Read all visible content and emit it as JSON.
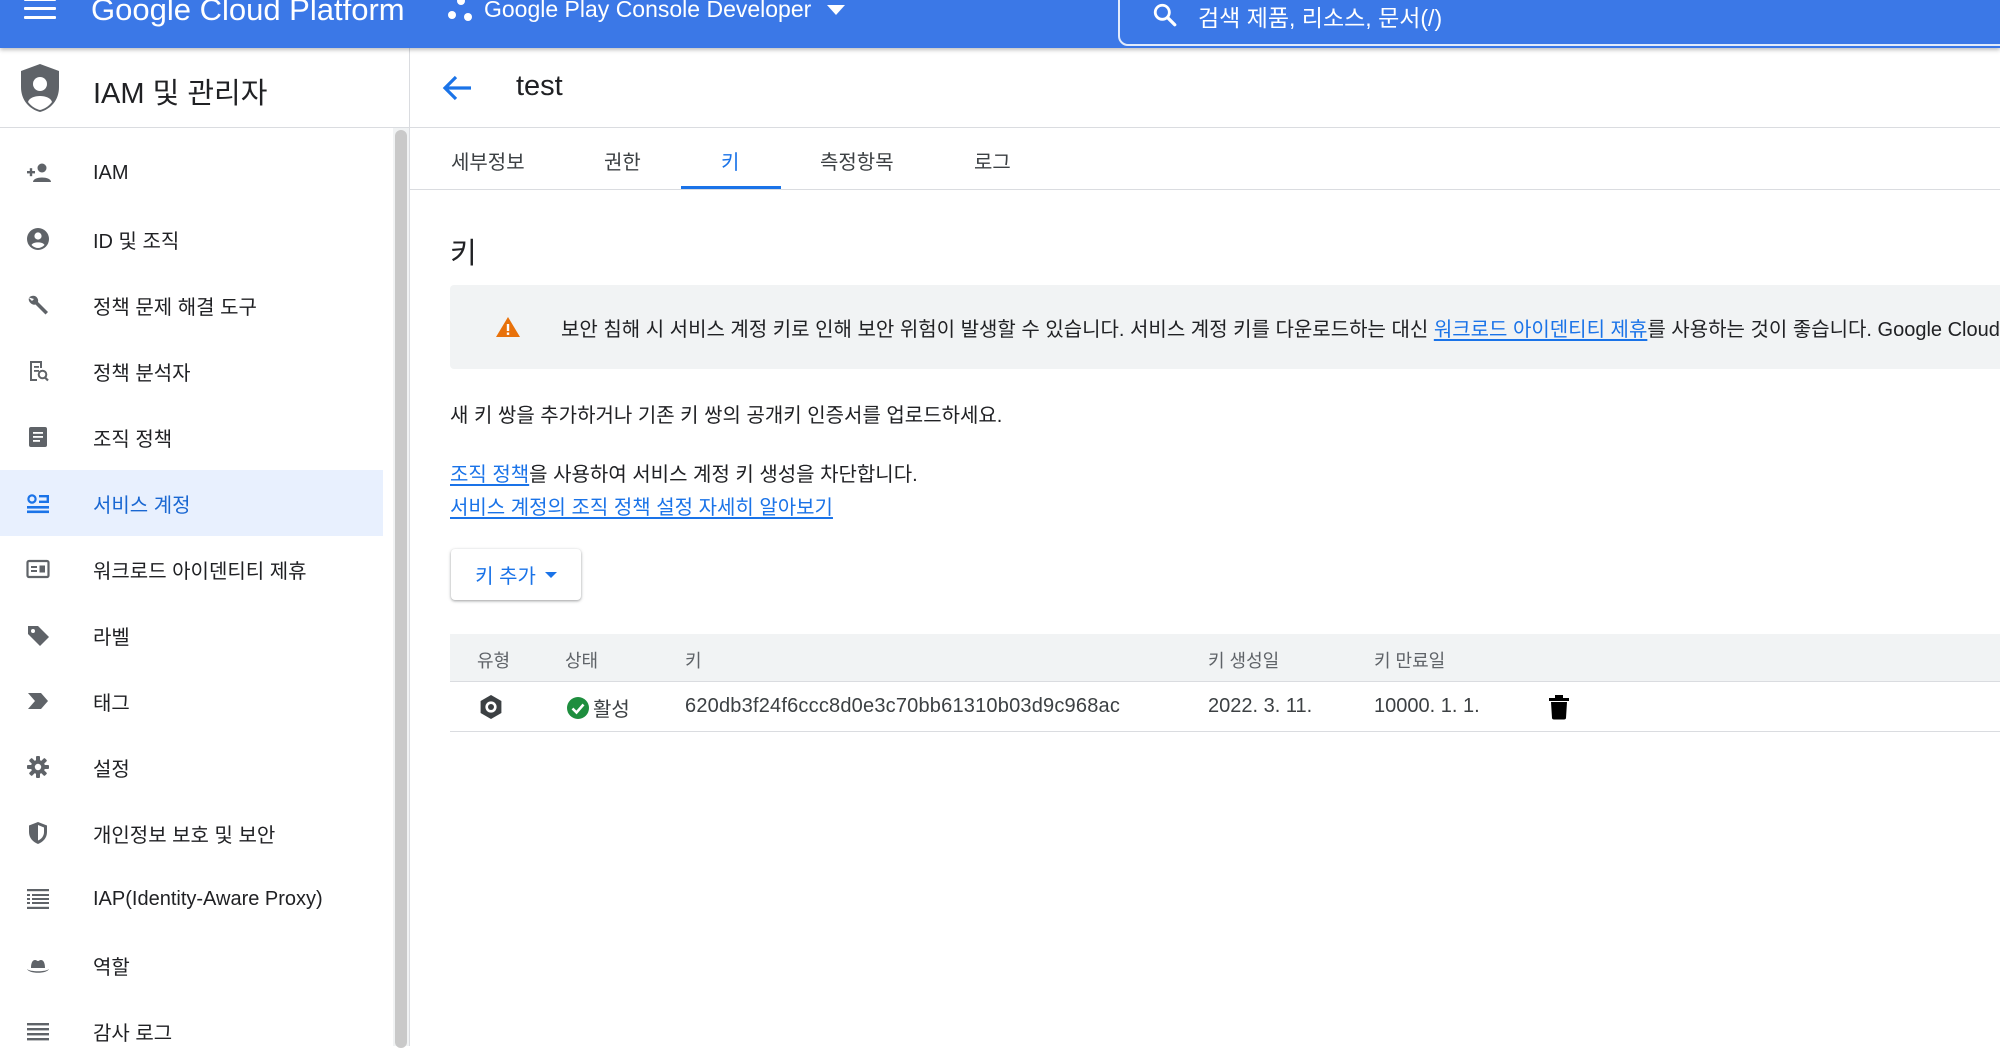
{
  "topbar": {
    "brand": "Google Cloud Platform",
    "project": "Google Play Console Developer",
    "search_text": "검색   제품, 리소스, 문서(/)",
    "color": "#3b78e7"
  },
  "sidebar": {
    "title": "IAM 및 관리자",
    "items": [
      {
        "label": "IAM",
        "icon": "person-add-icon"
      },
      {
        "label": "ID 및 조직",
        "icon": "account-circle-icon"
      },
      {
        "label": "정책 문제 해결 도구",
        "icon": "wrench-icon"
      },
      {
        "label": "정책 분석자",
        "icon": "policy-analyzer-icon"
      },
      {
        "label": "조직 정책",
        "icon": "document-icon"
      },
      {
        "label": "서비스 계정",
        "icon": "service-account-icon",
        "active": true
      },
      {
        "label": "워크로드 아이덴티티 제휴",
        "icon": "id-card-icon"
      },
      {
        "label": "라벨",
        "icon": "label-tag-icon"
      },
      {
        "label": "태그",
        "icon": "tag-chevron-icon"
      },
      {
        "label": "설정",
        "icon": "gear-icon"
      },
      {
        "label": "개인정보 보호 및 보안",
        "icon": "shield-icon"
      },
      {
        "label": "IAP(Identity-Aware Proxy)",
        "icon": "iap-icon"
      },
      {
        "label": "역할",
        "icon": "hat-icon"
      },
      {
        "label": "감사 로그",
        "icon": "list-lines-icon"
      }
    ]
  },
  "page": {
    "title": "test",
    "tabs": [
      {
        "label": "세부정보"
      },
      {
        "label": "권한"
      },
      {
        "label": "키",
        "active": true
      },
      {
        "label": "측정항목"
      },
      {
        "label": "로그"
      }
    ],
    "section_title": "키",
    "warning": {
      "text_before": "보안 침해 시 서비스 계정 키로 인해 보안 위험이 발생할 수 있습니다. 서비스 계정 키를 다운로드하는 대신 ",
      "link": "워크로드 아이덴티티 제휴",
      "text_after": "를 사용하는 것이 좋습니다. Google Cloud"
    },
    "intro": "새 키 쌍을 추가하거나 기존 키 쌍의 공개키 인증서를 업로드하세요.",
    "policy_link": "조직 정책",
    "policy_text": "을 사용하여 서비스 계정 키 생성을 차단합니다.",
    "learn_more_link": "서비스 계정의 조직 정책 설정 자세히 알아보기",
    "add_key_label": "키 추가",
    "table": {
      "headers": [
        "유형",
        "상태",
        "키",
        "키 생성일",
        "키 만료일"
      ],
      "rows": [
        {
          "type_icon": "service-key-icon",
          "status": "활성",
          "key": "620db3f24f6ccc8d0e3c70bb61310b03d9c968ac",
          "created": "2022. 3. 11.",
          "expires": "10000. 1. 1."
        }
      ]
    }
  },
  "colors": {
    "accent": "#1a73e8",
    "active_bg": "#e8f0fe",
    "warning": "#e8710a",
    "success": "#1e8e3e"
  }
}
